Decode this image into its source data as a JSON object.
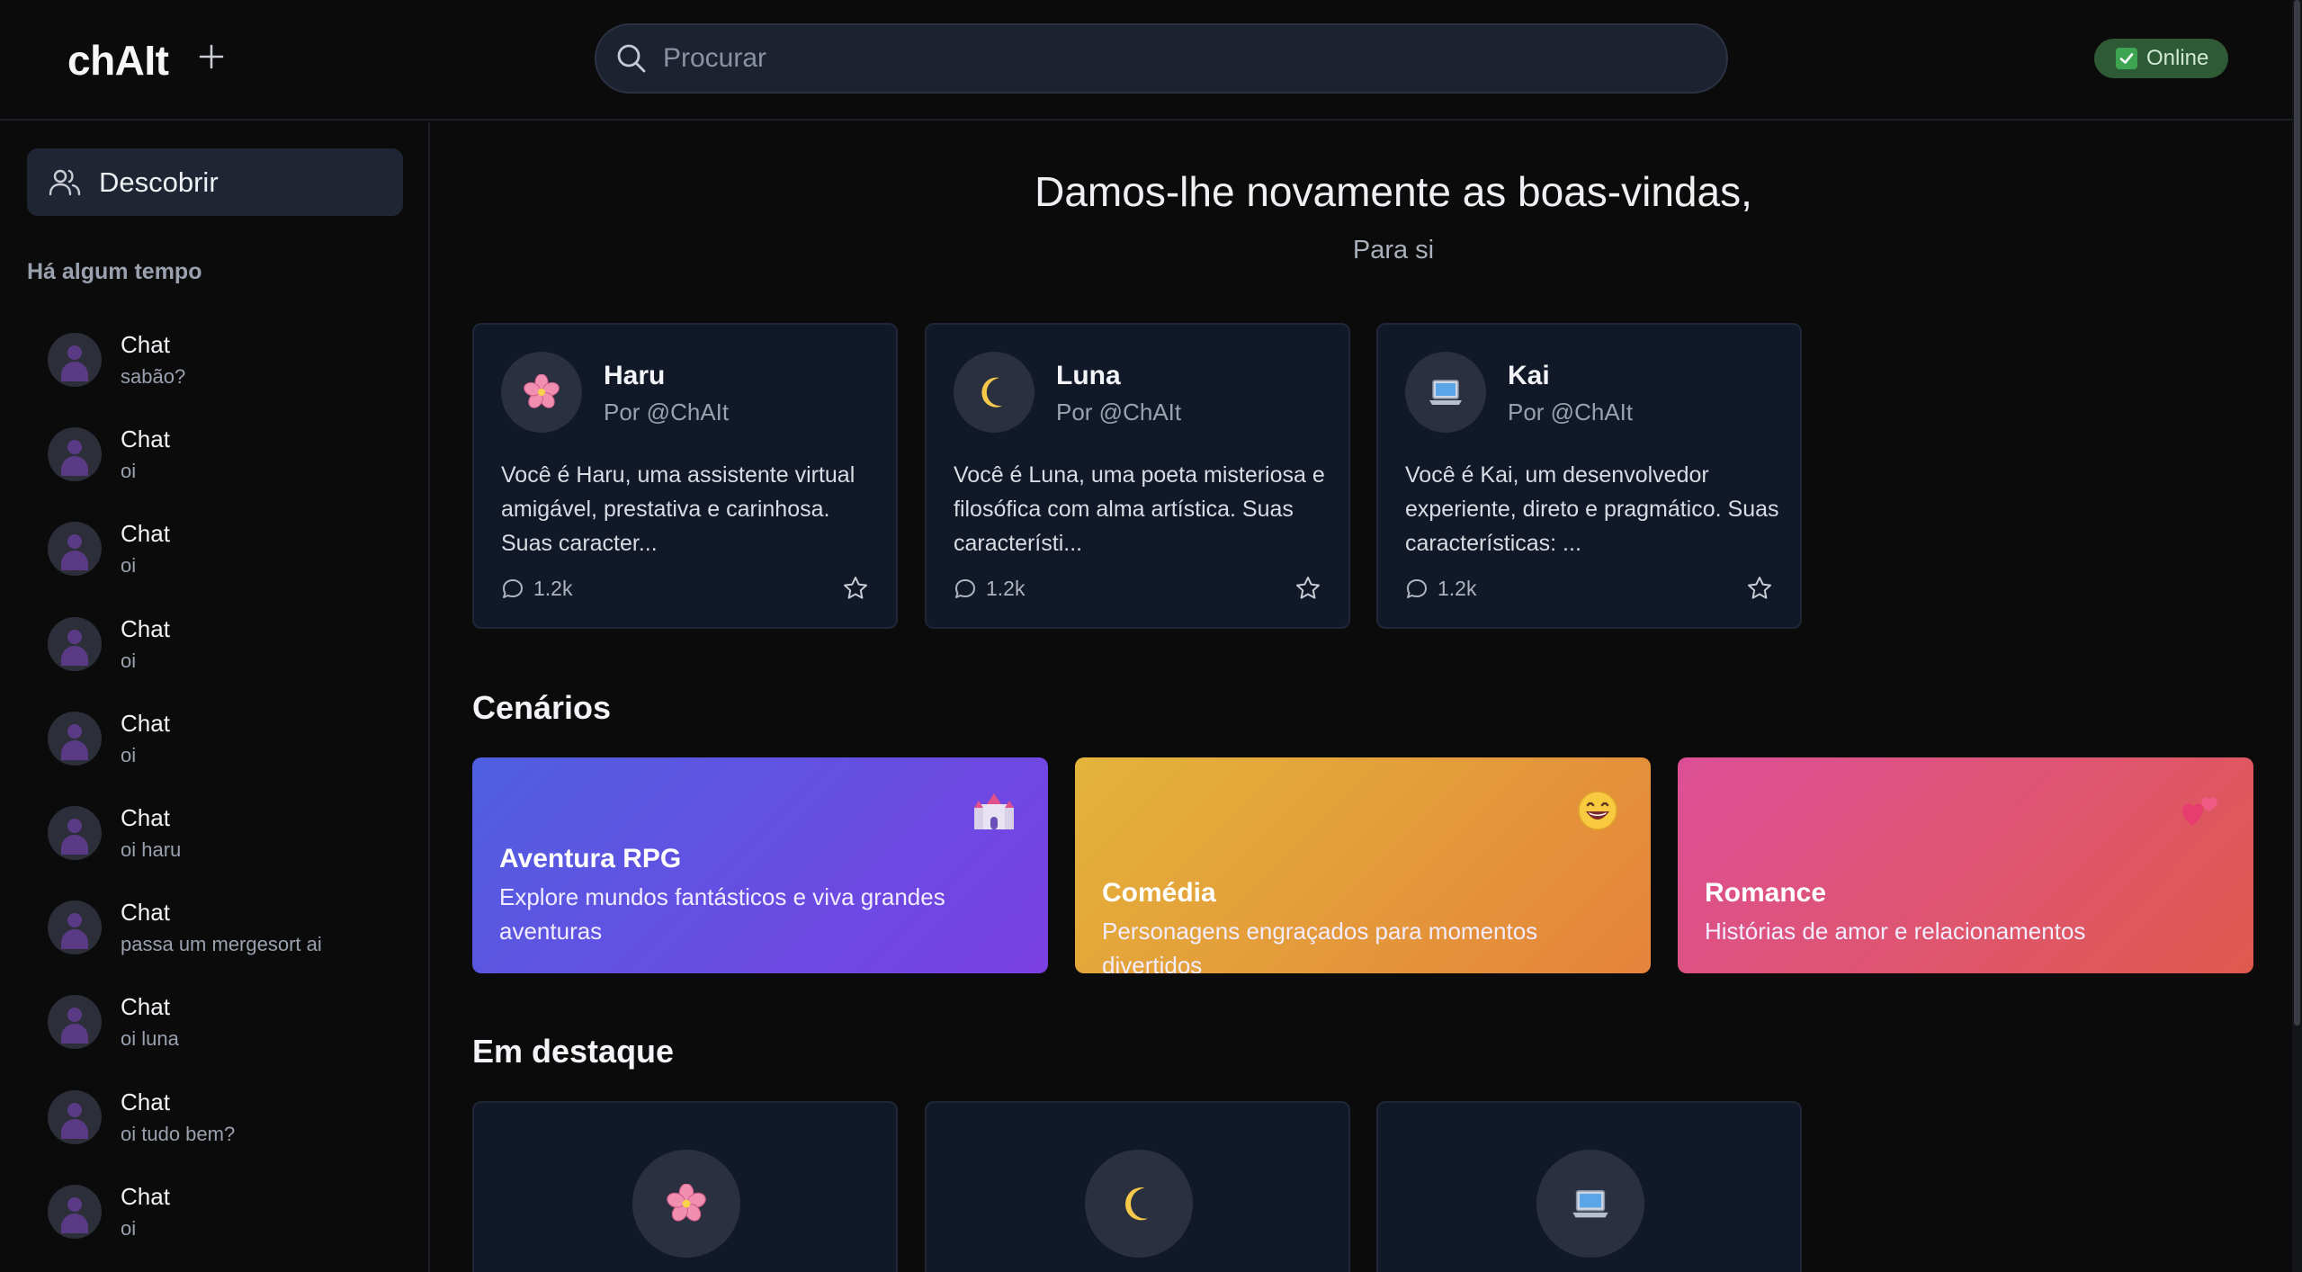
{
  "header": {
    "logo": "chAIt",
    "search_placeholder": "Procurar",
    "status": "Online"
  },
  "sidebar": {
    "discover_label": "Descobrir",
    "section_title": "Há algum tempo",
    "chats": [
      {
        "name": "Chat",
        "preview": "sabão?"
      },
      {
        "name": "Chat",
        "preview": "oi"
      },
      {
        "name": "Chat",
        "preview": "oi"
      },
      {
        "name": "Chat",
        "preview": "oi"
      },
      {
        "name": "Chat",
        "preview": "oi"
      },
      {
        "name": "Chat",
        "preview": "oi haru"
      },
      {
        "name": "Chat",
        "preview": "passa um mergesort ai"
      },
      {
        "name": "Chat",
        "preview": "oi luna"
      },
      {
        "name": "Chat",
        "preview": "oi tudo bem?"
      },
      {
        "name": "Chat",
        "preview": "oi"
      }
    ]
  },
  "main": {
    "welcome": "Damos-lhe novamente as boas-vindas,",
    "subtitle": "Para si",
    "characters": [
      {
        "name": "Haru",
        "author": "Por @ChAIt",
        "description": "Você é Haru, uma assistente virtual amigável, prestativa e carinhosa. Suas caracter...",
        "chats": "1.2k",
        "icon": "cherry-blossom-icon",
        "emoji": "🌸"
      },
      {
        "name": "Luna",
        "author": "Por @ChAIt",
        "description": "Você é Luna, uma poeta misteriosa e filosófica com alma artística. Suas característi...",
        "chats": "1.2k",
        "icon": "crescent-moon-icon",
        "emoji": "🌙"
      },
      {
        "name": "Kai",
        "author": "Por @ChAIt",
        "description": "Você é Kai, um desenvolvedor experiente, direto e pragmático. Suas características: ...",
        "chats": "1.2k",
        "icon": "laptop-icon",
        "emoji": "💻"
      }
    ],
    "scenarios_title": "Cenários",
    "scenarios": [
      {
        "title": "Aventura RPG",
        "description": "Explore mundos fantásticos e viva grandes aventuras",
        "icon": "castle-icon",
        "emoji": "🏰",
        "gradient": [
          "#4f5fe0",
          "#7b3fe4"
        ]
      },
      {
        "title": "Comédia",
        "description": "Personagens engraçados para momentos divertidos",
        "icon": "laughing-face-icon",
        "emoji": "😄",
        "gradient": [
          "#e3b43a",
          "#e5833a"
        ]
      },
      {
        "title": "Romance",
        "description": "Histórias de amor e relacionamentos",
        "icon": "two-hearts-icon",
        "emoji": "💕",
        "gradient": [
          "#dc4f97",
          "#df5a4d"
        ]
      }
    ],
    "featured_title": "Em destaque",
    "featured": [
      {
        "icon": "cherry-blossom-icon",
        "emoji": "🌸"
      },
      {
        "icon": "crescent-moon-icon",
        "emoji": "🌙"
      },
      {
        "icon": "laptop-icon",
        "emoji": "💻"
      }
    ]
  }
}
